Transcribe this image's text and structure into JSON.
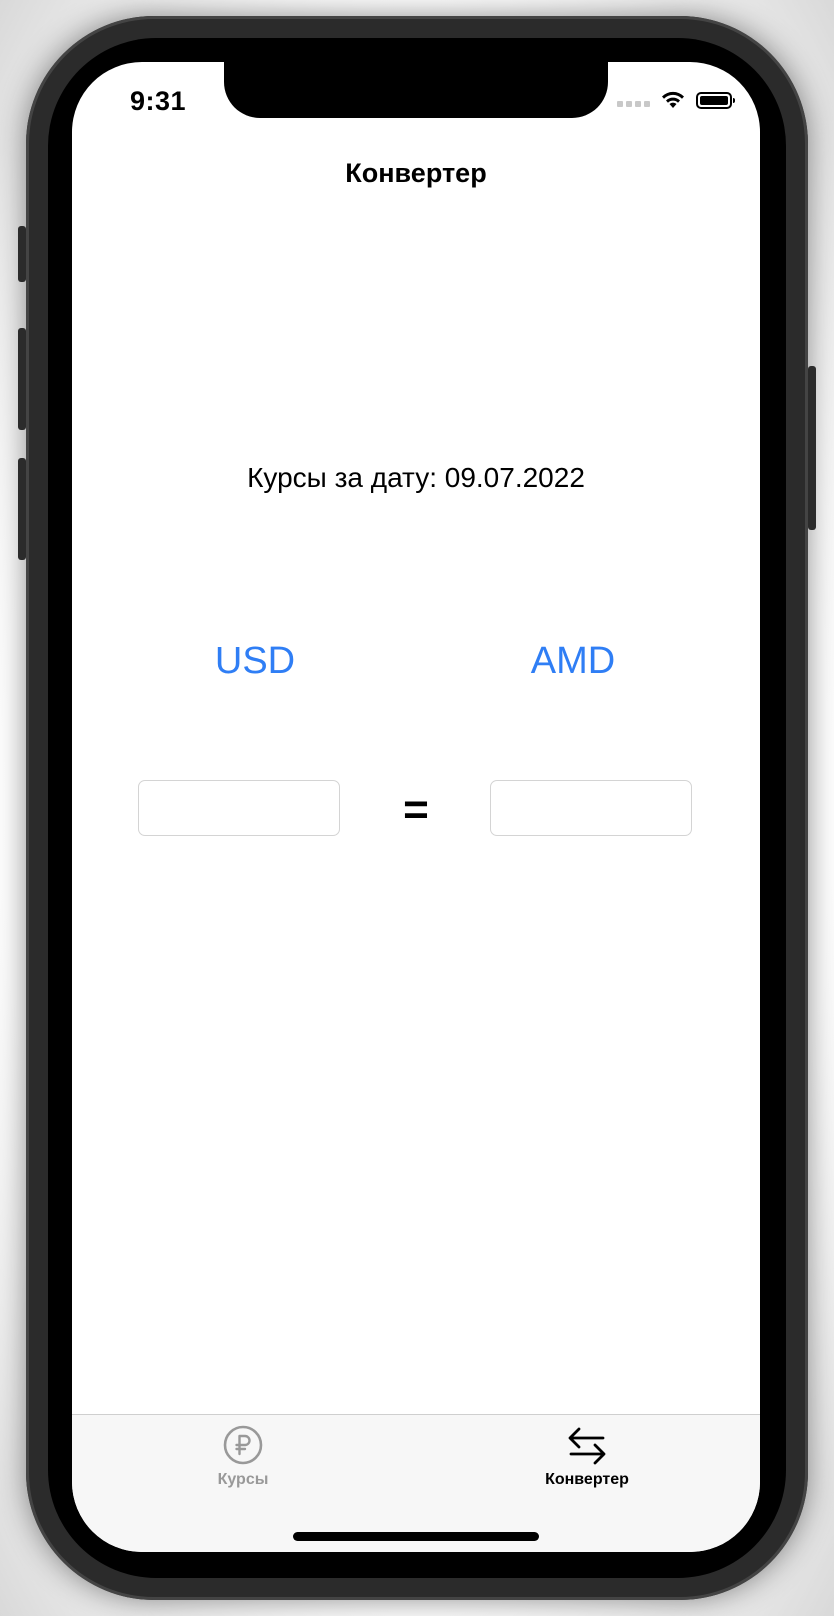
{
  "status_bar": {
    "time": "9:31"
  },
  "nav": {
    "title": "Конвертер"
  },
  "rates_date": {
    "label": "Курсы за дату: 09.07.2022"
  },
  "converter": {
    "from_currency": "USD",
    "to_currency": "AMD",
    "from_amount": "",
    "to_amount": "",
    "equals_sign": "="
  },
  "tabbar": {
    "tabs": [
      {
        "label": "Курсы",
        "icon": "ruble-circle-icon",
        "active": false
      },
      {
        "label": "Конвертер",
        "icon": "arrows-left-right-icon",
        "active": true
      }
    ]
  },
  "colors": {
    "accent": "#2f7ef5",
    "inactive_tab": "#999999",
    "active_tab": "#000000",
    "tabbar_bg": "#f7f7f7"
  }
}
